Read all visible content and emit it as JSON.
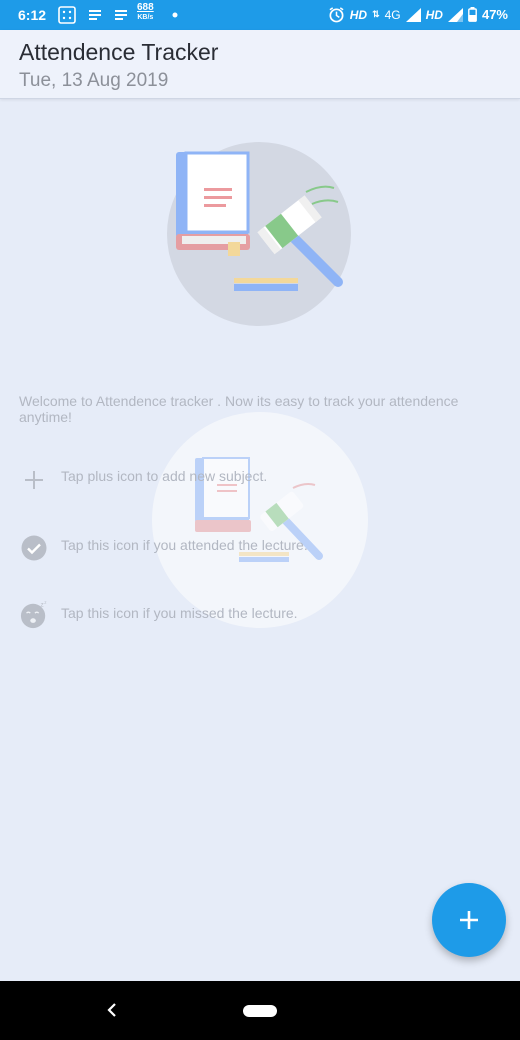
{
  "status_bar": {
    "time": "6:12",
    "speed_value": "688",
    "speed_unit": "KB/s",
    "network_1": "HD",
    "network_type": "4G",
    "network_2": "HD",
    "battery": "47%"
  },
  "app_bar": {
    "title": "Attendence Tracker",
    "date": "Tue, 13 Aug 2019"
  },
  "main": {
    "welcome": "Welcome to Attendence tracker . Now its easy to track your attendence anytime!",
    "tips": [
      {
        "icon": "plus-icon",
        "text": "Tap plus icon to add new subject."
      },
      {
        "icon": "check-circle-icon",
        "text": "Tap this icon if you attended the lecture."
      },
      {
        "icon": "sleep-face-icon",
        "text": "Tap this icon if you missed the lecture."
      }
    ]
  },
  "fab": {
    "icon": "plus-icon"
  },
  "colors": {
    "primary": "#1e9be8",
    "background": "#e6ecf8",
    "muted_text": "#b2b7c2"
  }
}
